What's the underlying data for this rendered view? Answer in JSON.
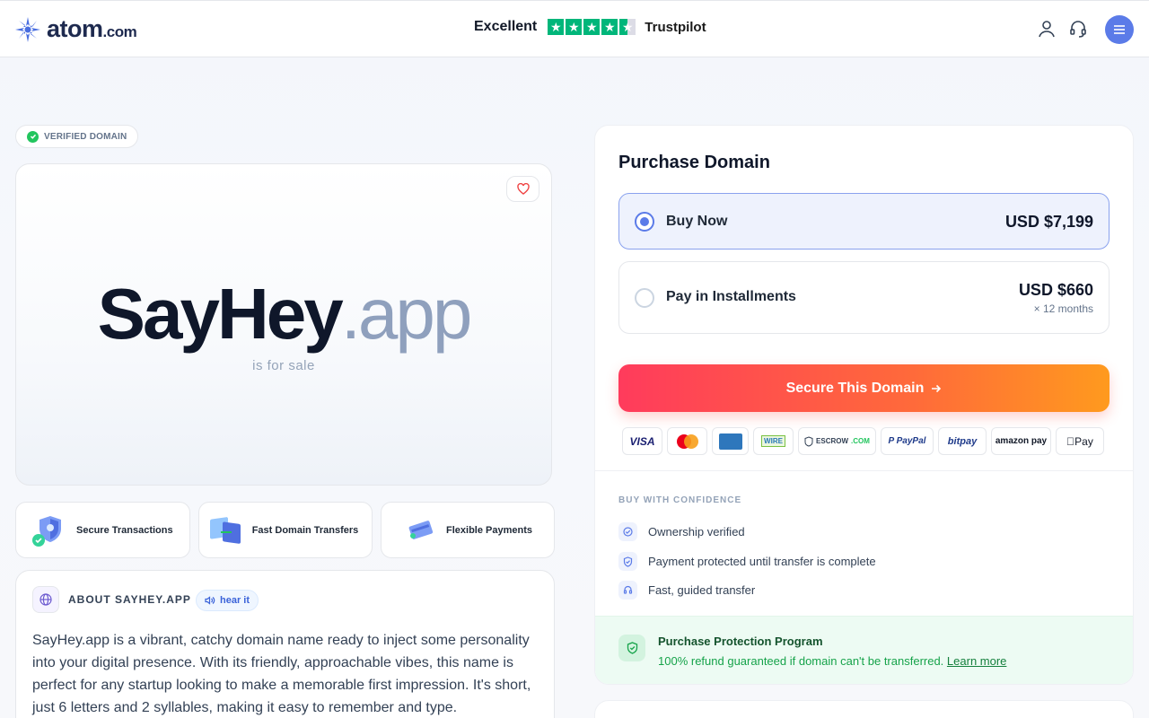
{
  "header": {
    "logo_text": "atom",
    "logo_suffix": ".com",
    "trustpilot_rating": "Excellent",
    "trustpilot_name": "Trustpilot",
    "trustpilot_stars": 4.5,
    "icons": [
      "user-icon",
      "headset-icon",
      "menu-icon"
    ],
    "menu_color": "#5b7be8"
  },
  "badge": {
    "label": "VERIFIED DOMAIN"
  },
  "hero": {
    "domain_name": "SayHey",
    "domain_tld": ".app",
    "subtitle": "is for sale"
  },
  "features": [
    {
      "label": "Secure Transactions",
      "icon": "shield-check-icon"
    },
    {
      "label": "Fast Domain Transfers",
      "icon": "transfer-icon"
    },
    {
      "label": "Flexible Payments",
      "icon": "card-icon"
    }
  ],
  "about": {
    "title": "ABOUT SAYHEY.APP",
    "hear_label": "hear it",
    "text": "SayHey.app is a vibrant, catchy domain name ready to inject some personality into your digital presence. With its friendly, approachable vibes, this name is perfect for any startup looking to make a memorable first impression. It's short, just 6 letters and 2 syllables, making it easy to remember and type."
  },
  "purchase": {
    "title": "Purchase Domain",
    "options": [
      {
        "label": "Buy Now",
        "price": "USD $7,199",
        "selected": true
      },
      {
        "label": "Pay in Installments",
        "price": "USD $660",
        "sub": "× 12 months",
        "selected": false
      }
    ],
    "cta_label": "Secure This Domain",
    "payment_methods": [
      "VISA",
      "MasterCard",
      "AMEX",
      "WIRE TRANSFER",
      "ESCROW.COM",
      "PayPal",
      "bitpay",
      "amazon pay",
      "Pay"
    ],
    "accent_color": "#ff3b5c"
  },
  "confidence": {
    "title": "BUY WITH CONFIDENCE",
    "items": [
      "Ownership verified",
      "Payment protected until transfer is complete",
      "Fast, guided transfer"
    ]
  },
  "protection": {
    "title": "Purchase Protection Program",
    "text": "100% refund guaranteed if domain can't be transferred.",
    "link": "Learn more"
  }
}
